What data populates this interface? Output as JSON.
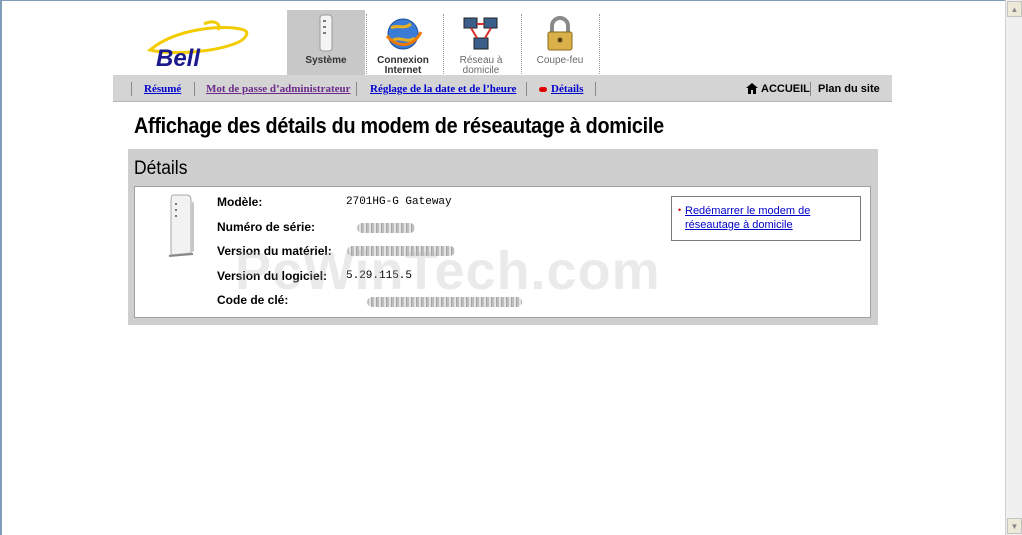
{
  "logo": {
    "text": "Bell",
    "color": "#f6d000"
  },
  "nav_tabs": [
    {
      "label": "Système",
      "active": true,
      "icon": "modem-icon"
    },
    {
      "label": "Connexion Internet",
      "active": false,
      "icon": "globe-icon"
    },
    {
      "label": "Réseau à domicile",
      "active": false,
      "icon": "network-icon"
    },
    {
      "label": "Coupe-feu",
      "active": false,
      "icon": "lock-icon"
    }
  ],
  "subnav": {
    "items": [
      "Résumé",
      "Mot de passe d’administrateur",
      "Réglage de la date et de l’heure",
      "Détails"
    ],
    "home": "ACCUEIL",
    "sitemap": "Plan du site"
  },
  "page_title": "Affichage des détails du modem de réseautage à domicile",
  "details": {
    "header": "Détails",
    "rows": [
      {
        "label": "Modèle:",
        "value": "2701HG-G Gateway"
      },
      {
        "label": "Numéro de série:",
        "value": ""
      },
      {
        "label": "Version du matériel:",
        "value": ""
      },
      {
        "label": "Version du logiciel:",
        "value": "5.29.115.5"
      },
      {
        "label": "Code de clé:",
        "value": ""
      }
    ],
    "action_link": "Redémarrer le modem de réseautage à domicile"
  },
  "watermark": "PcWinTech.com",
  "colors": {
    "link": "#0000cc",
    "visited": "#6b2a8a",
    "subnav_bg": "#d4d4d4",
    "details_bg": "#cfcfcf"
  }
}
